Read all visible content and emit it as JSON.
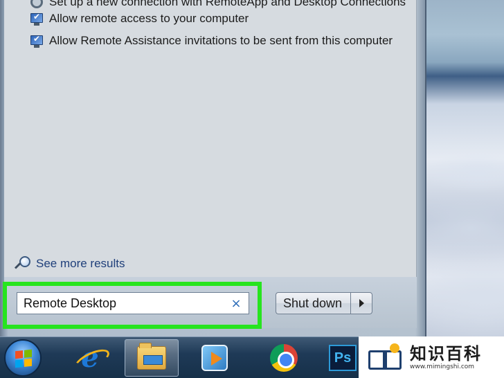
{
  "search_results": {
    "items": [
      {
        "label": "Set up a new connection with RemoteApp and Desktop Connections",
        "icon": "network-settings-icon"
      },
      {
        "label": "Allow remote access to your computer",
        "icon": "remote-monitor-icon"
      },
      {
        "label": "Allow Remote Assistance invitations to be sent from this computer",
        "icon": "remote-monitor-icon"
      }
    ],
    "see_more_label": "See more results"
  },
  "search": {
    "value": "Remote Desktop",
    "clear_glyph": "×"
  },
  "shutdown": {
    "label": "Shut down"
  },
  "taskbar": {
    "apps": [
      "start-orb",
      "internet-explorer",
      "windows-explorer",
      "windows-media-player",
      "google-chrome",
      "photoshop"
    ],
    "ps_label": "Ps"
  },
  "watermark": {
    "title": "知识百科",
    "url": "www.mimingshi.com"
  },
  "colors": {
    "highlight": "#27e41f",
    "link": "#1f3f7a"
  }
}
